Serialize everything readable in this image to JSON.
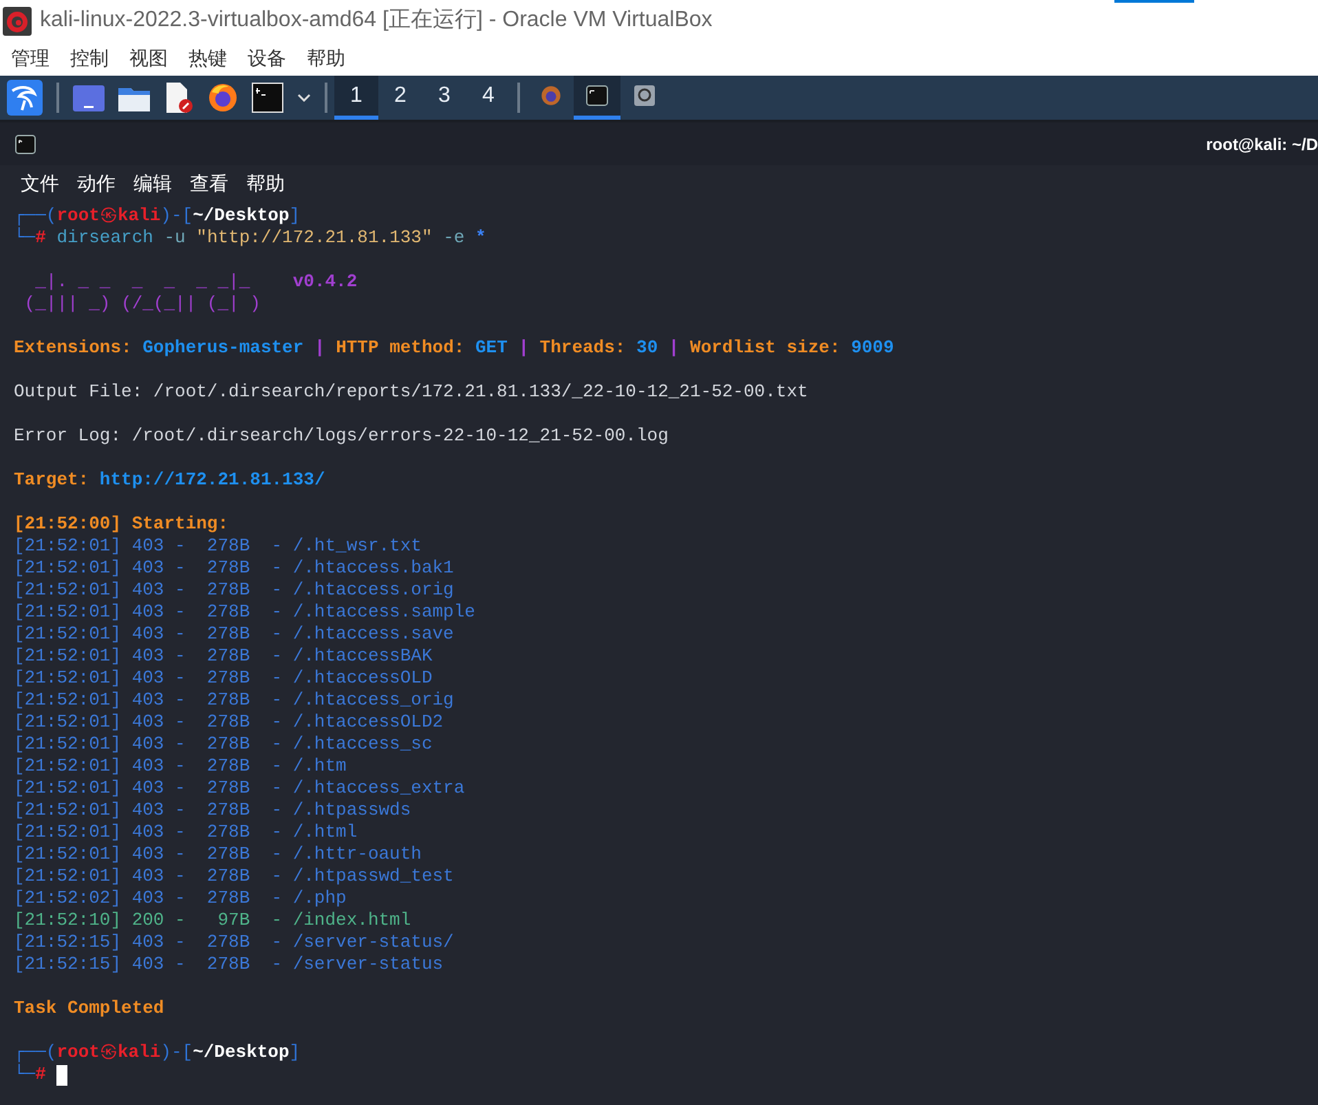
{
  "window": {
    "title": "kali-linux-2022.3-virtualbox-amd64 [正在运行] - Oracle VM VirtualBox"
  },
  "menu": [
    "管理",
    "控制",
    "视图",
    "热键",
    "设备",
    "帮助"
  ],
  "panel": {
    "launchers": [
      {
        "kind": "kali"
      },
      {
        "kind": "desktop"
      },
      {
        "kind": "folder"
      },
      {
        "kind": "editor"
      },
      {
        "kind": "firefox"
      },
      {
        "kind": "terminal"
      },
      {
        "kind": "dropdown"
      }
    ],
    "workspaces": [
      {
        "label": "1",
        "selected": true
      },
      {
        "label": "2",
        "selected": false
      },
      {
        "label": "3",
        "selected": false
      },
      {
        "label": "4",
        "selected": false
      }
    ],
    "tasks": [
      {
        "kind": "firefox",
        "selected": false
      },
      {
        "kind": "terminal",
        "selected": true
      },
      {
        "kind": "disk",
        "selected": false
      }
    ]
  },
  "terminal": {
    "title": "root@kali: ~/D",
    "menu": [
      "文件",
      "动作",
      "编辑",
      "查看",
      "帮助"
    ],
    "lines": [
      {
        "kind": "text",
        "segments": [
          {
            "text": "┌──(",
            "kind": "frame"
          },
          {
            "text": "root",
            "kind": "user"
          },
          {
            "text": "㉿",
            "kind": "at"
          },
          {
            "text": "kali",
            "kind": "user"
          },
          {
            "text": ")-[",
            "kind": "frame"
          },
          {
            "text": "~/Desktop",
            "kind": "path"
          },
          {
            "text": "]",
            "kind": "frame"
          }
        ]
      },
      {
        "kind": "text",
        "segments": [
          {
            "text": "└─",
            "kind": "frame"
          },
          {
            "text": "#",
            "kind": "sign"
          },
          {
            "text": " dirsearch",
            "kind": "program"
          },
          {
            "text": " -u",
            "kind": "option"
          },
          {
            "text": " \"http://172.21.81.133\"",
            "kind": "string"
          },
          {
            "text": " -e",
            "kind": "option"
          },
          {
            "text": " *",
            "kind": "glob"
          }
        ]
      },
      {
        "kind": "blank"
      },
      {
        "kind": "text",
        "segments": [
          {
            "text": "  _|. _ _  _  _  _ _|_    ",
            "kind": "logo"
          },
          {
            "text": "v0.4.2",
            "kind": "version"
          }
        ]
      },
      {
        "kind": "text",
        "segments": [
          {
            "text": " (_||| _) (/_(_|| (_| )",
            "kind": "logo"
          }
        ]
      },
      {
        "kind": "blank"
      },
      {
        "kind": "text",
        "segments": [
          {
            "text": "Extensions: ",
            "kind": "label"
          },
          {
            "text": "Gopherus-master",
            "kind": "value"
          },
          {
            "text": " | ",
            "kind": "separator"
          },
          {
            "text": "HTTP method: ",
            "kind": "label"
          },
          {
            "text": "GET",
            "kind": "value"
          },
          {
            "text": " | ",
            "kind": "separator"
          },
          {
            "text": "Threads: ",
            "kind": "label"
          },
          {
            "text": "30",
            "kind": "value"
          },
          {
            "text": " | ",
            "kind": "separator"
          },
          {
            "text": "Wordlist size: ",
            "kind": "label"
          },
          {
            "text": "9009",
            "kind": "value"
          }
        ]
      },
      {
        "kind": "blank"
      },
      {
        "kind": "text",
        "segments": [
          {
            "text": "Output File: /root/.dirsearch/reports/172.21.81.133/_22-10-12_21-52-00.txt",
            "kind": "plain"
          }
        ]
      },
      {
        "kind": "blank"
      },
      {
        "kind": "text",
        "segments": [
          {
            "text": "Error Log: /root/.dirsearch/logs/errors-22-10-12_21-52-00.log",
            "kind": "plain"
          }
        ]
      },
      {
        "kind": "blank"
      },
      {
        "kind": "text",
        "segments": [
          {
            "text": "Target: ",
            "kind": "label"
          },
          {
            "text": "http://172.21.81.133/",
            "kind": "value"
          }
        ]
      },
      {
        "kind": "blank"
      },
      {
        "kind": "text",
        "segments": [
          {
            "text": "[21:52:00] Starting:",
            "kind": "label"
          }
        ]
      },
      {
        "kind": "text",
        "segments": [
          {
            "text": "[21:52:01] 403 -  278B  - /.ht_wsr.txt",
            "kind": "forbidden"
          }
        ]
      },
      {
        "kind": "text",
        "segments": [
          {
            "text": "[21:52:01] 403 -  278B  - /.htaccess.bak1",
            "kind": "forbidden"
          }
        ]
      },
      {
        "kind": "text",
        "segments": [
          {
            "text": "[21:52:01] 403 -  278B  - /.htaccess.orig",
            "kind": "forbidden"
          }
        ]
      },
      {
        "kind": "text",
        "segments": [
          {
            "text": "[21:52:01] 403 -  278B  - /.htaccess.sample",
            "kind": "forbidden"
          }
        ]
      },
      {
        "kind": "text",
        "segments": [
          {
            "text": "[21:52:01] 403 -  278B  - /.htaccess.save",
            "kind": "forbidden"
          }
        ]
      },
      {
        "kind": "text",
        "segments": [
          {
            "text": "[21:52:01] 403 -  278B  - /.htaccessBAK",
            "kind": "forbidden"
          }
        ]
      },
      {
        "kind": "text",
        "segments": [
          {
            "text": "[21:52:01] 403 -  278B  - /.htaccessOLD",
            "kind": "forbidden"
          }
        ]
      },
      {
        "kind": "text",
        "segments": [
          {
            "text": "[21:52:01] 403 -  278B  - /.htaccess_orig",
            "kind": "forbidden"
          }
        ]
      },
      {
        "kind": "text",
        "segments": [
          {
            "text": "[21:52:01] 403 -  278B  - /.htaccessOLD2",
            "kind": "forbidden"
          }
        ]
      },
      {
        "kind": "text",
        "segments": [
          {
            "text": "[21:52:01] 403 -  278B  - /.htaccess_sc",
            "kind": "forbidden"
          }
        ]
      },
      {
        "kind": "text",
        "segments": [
          {
            "text": "[21:52:01] 403 -  278B  - /.htm",
            "kind": "forbidden"
          }
        ]
      },
      {
        "kind": "text",
        "segments": [
          {
            "text": "[21:52:01] 403 -  278B  - /.htaccess_extra",
            "kind": "forbidden"
          }
        ]
      },
      {
        "kind": "text",
        "segments": [
          {
            "text": "[21:52:01] 403 -  278B  - /.htpasswds",
            "kind": "forbidden"
          }
        ]
      },
      {
        "kind": "text",
        "segments": [
          {
            "text": "[21:52:01] 403 -  278B  - /.html",
            "kind": "forbidden"
          }
        ]
      },
      {
        "kind": "text",
        "segments": [
          {
            "text": "[21:52:01] 403 -  278B  - /.httr-oauth",
            "kind": "forbidden"
          }
        ]
      },
      {
        "kind": "text",
        "segments": [
          {
            "text": "[21:52:01] 403 -  278B  - /.htpasswd_test",
            "kind": "forbidden"
          }
        ]
      },
      {
        "kind": "text",
        "segments": [
          {
            "text": "[21:52:02] 403 -  278B  - /.php",
            "kind": "forbidden"
          }
        ]
      },
      {
        "kind": "text",
        "segments": [
          {
            "text": "[21:52:10] 200 -   97B  - /index.html",
            "kind": "ok"
          }
        ]
      },
      {
        "kind": "text",
        "segments": [
          {
            "text": "[21:52:15] 403 -  278B  - /server-status/",
            "kind": "forbidden"
          }
        ]
      },
      {
        "kind": "text",
        "segments": [
          {
            "text": "[21:52:15] 403 -  278B  - /server-status",
            "kind": "forbidden"
          }
        ]
      },
      {
        "kind": "blank"
      },
      {
        "kind": "text",
        "segments": [
          {
            "text": "Task Completed",
            "kind": "label"
          }
        ]
      },
      {
        "kind": "blank"
      },
      {
        "kind": "text",
        "segments": [
          {
            "text": "┌──(",
            "kind": "frame"
          },
          {
            "text": "root",
            "kind": "user"
          },
          {
            "text": "㉿",
            "kind": "at"
          },
          {
            "text": "kali",
            "kind": "user"
          },
          {
            "text": ")-[",
            "kind": "frame"
          },
          {
            "text": "~/Desktop",
            "kind": "path"
          },
          {
            "text": "]",
            "kind": "frame"
          }
        ]
      },
      {
        "kind": "text",
        "segments": [
          {
            "text": "└─",
            "kind": "frame"
          },
          {
            "text": "#",
            "kind": "sign"
          }
        ],
        "cursor": true
      }
    ]
  }
}
